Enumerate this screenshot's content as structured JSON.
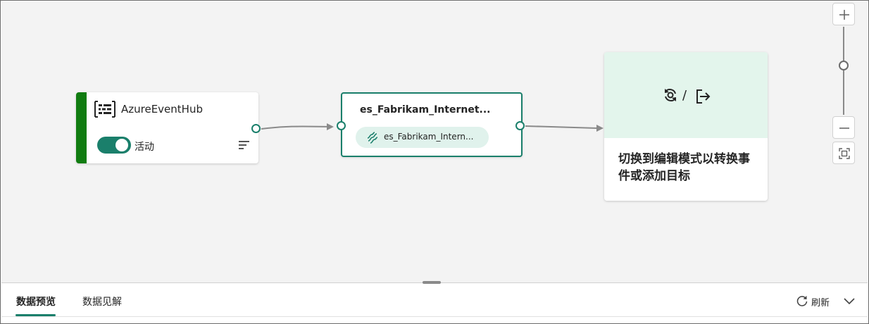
{
  "canvas": {
    "source": {
      "title": "AzureEventHub",
      "toggle_label": "活动",
      "toggle_on": true,
      "accent_color": "#107c10",
      "icon": "event-hub-icon"
    },
    "stream": {
      "title": "es_Fabrikam_Internet...",
      "chip_label": "es_Fabrikam_Intern...",
      "chip_icon": "eventstream-icon",
      "border_color": "#1a7f6b"
    },
    "destination": {
      "icons": [
        "transform-event-icon",
        "add-destination-icon"
      ],
      "separator": "/",
      "message": "切换到编辑模式以转换事件或添加目标",
      "header_color": "#e3f5ec"
    },
    "zoom": {
      "zoom_in_icon": "plus-icon",
      "zoom_out_icon": "minus-icon",
      "fit_icon": "fit-to-screen-icon"
    }
  },
  "bottom_panel": {
    "tabs": [
      {
        "label": "数据预览",
        "active": true
      },
      {
        "label": "数据见解",
        "active": false
      }
    ],
    "refresh_label": "刷新",
    "accent_color": "#1a7f6b"
  }
}
